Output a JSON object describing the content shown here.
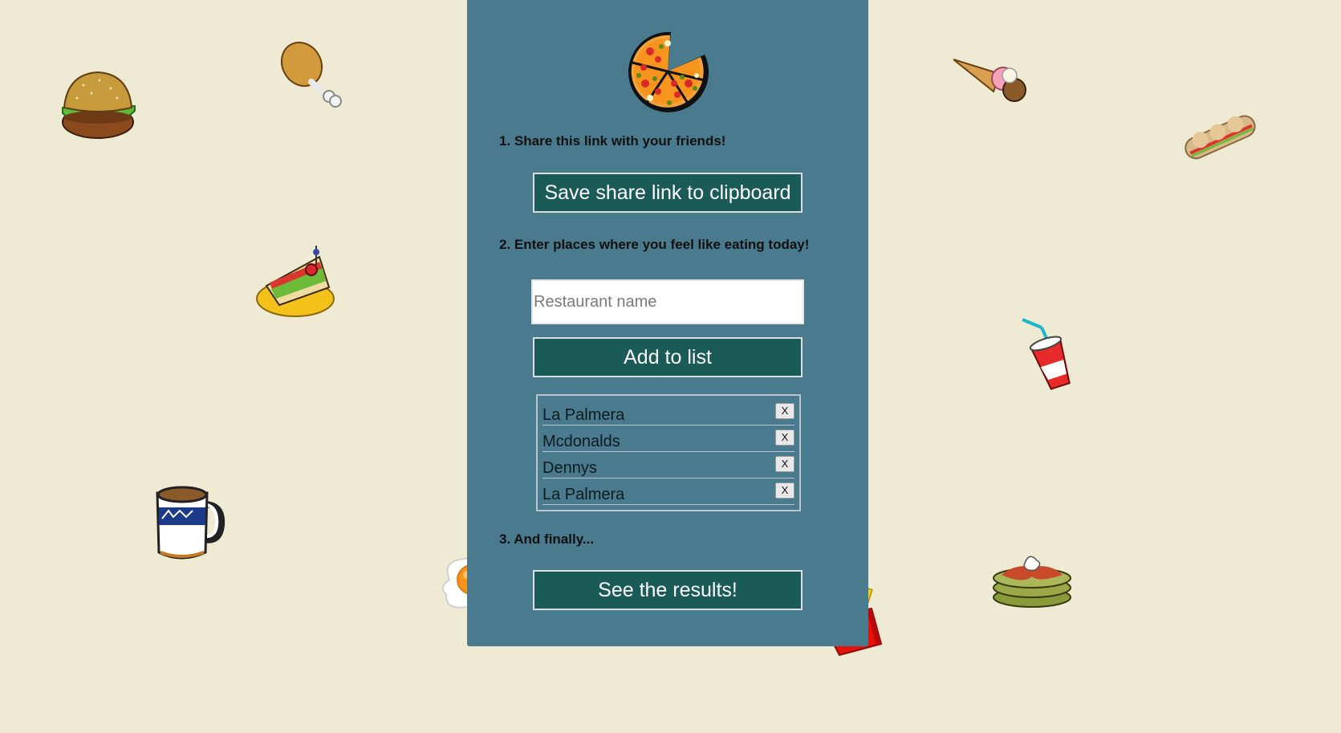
{
  "step1": {
    "text": "1. Share this link with your friends!",
    "button_label": "Save share link to clipboard"
  },
  "step2": {
    "text": "2. Enter places where you feel like eating today!",
    "input": {
      "placeholder": "Restaurant name",
      "value": ""
    },
    "add_button_label": "Add to list"
  },
  "restaurants": [
    {
      "name": "La Palmera",
      "remove_label": "X"
    },
    {
      "name": "Mcdonalds",
      "remove_label": "X"
    },
    {
      "name": "Dennys",
      "remove_label": "X"
    },
    {
      "name": "La Palmera",
      "remove_label": "X"
    }
  ],
  "step3": {
    "text": "3. And finally...",
    "button_label": "See the results!"
  },
  "colors": {
    "background": "#eeead3",
    "panel": "#4a7a8e",
    "button": "#1a5a57",
    "button_text": "#ffffff"
  },
  "icons": [
    "pizza-logo-icon",
    "burger-icon",
    "chicken-leg-icon",
    "club-sandwich-icon",
    "coffee-mug-icon",
    "fried-egg-icon",
    "french-fries-icon",
    "ice-cream-cone-icon",
    "sub-sandwich-icon",
    "soda-cup-icon",
    "pancakes-icon"
  ]
}
